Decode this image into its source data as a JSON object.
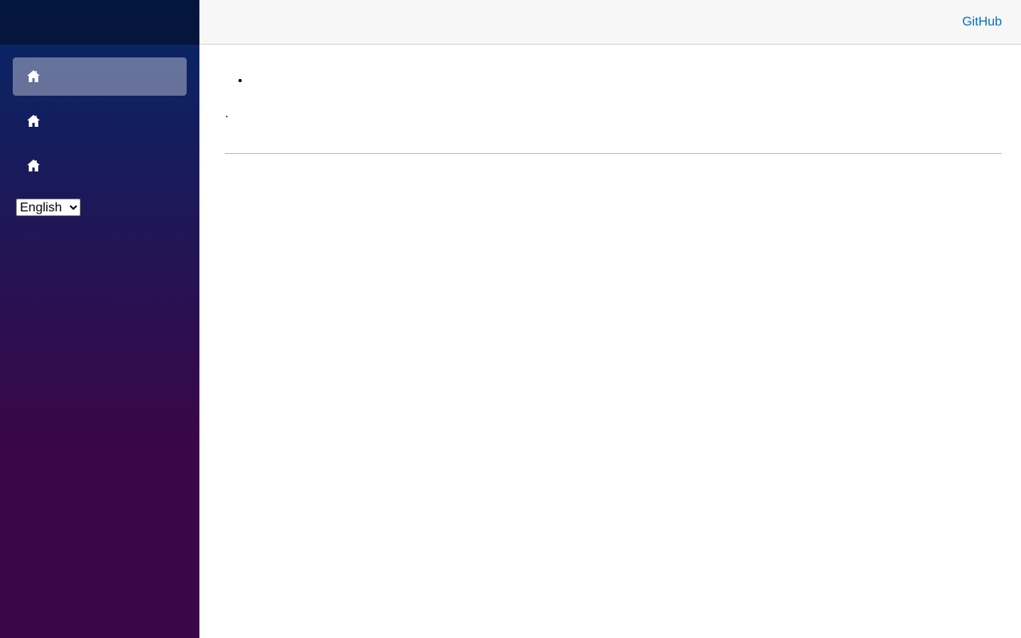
{
  "header": {
    "github_label": "GitHub"
  },
  "sidebar": {
    "items": [
      {
        "icon": "home-icon",
        "label": "",
        "active": true
      },
      {
        "icon": "home-icon",
        "label": "",
        "active": false
      },
      {
        "icon": "home-icon",
        "label": "",
        "active": false
      }
    ],
    "language": {
      "selected": "English",
      "options": [
        "English"
      ]
    }
  },
  "main": {
    "list_items": [
      ""
    ],
    "paragraph": "."
  },
  "colors": {
    "sidebar_gradient_top": "#052767",
    "sidebar_gradient_bottom": "#3a0647",
    "link": "#0071c1",
    "top_row_bg": "#f7f7f7"
  }
}
